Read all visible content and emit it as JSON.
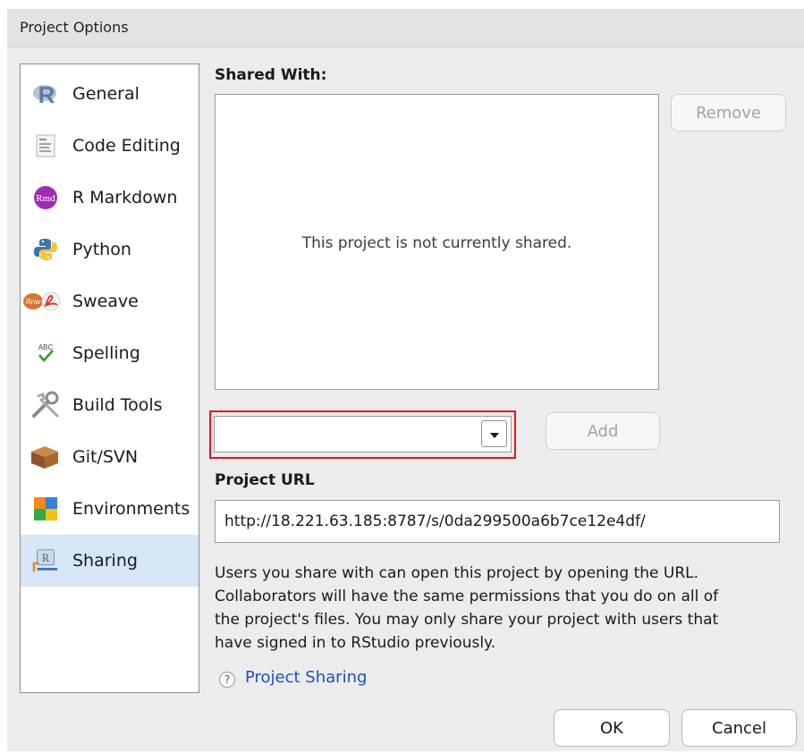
{
  "window": {
    "title": "Project Options"
  },
  "sidebar": {
    "items": [
      {
        "label": "General",
        "icon": "r-logo-icon"
      },
      {
        "label": "Code Editing",
        "icon": "code-document-icon"
      },
      {
        "label": "R Markdown",
        "icon": "rmd-icon",
        "icon_text": "Rmd"
      },
      {
        "label": "Python",
        "icon": "python-icon"
      },
      {
        "label": "Sweave",
        "icon": "sweave-icon",
        "icon_text": "Rnw"
      },
      {
        "label": "Spelling",
        "icon": "spelling-icon",
        "icon_text": "ABC"
      },
      {
        "label": "Build Tools",
        "icon": "build-tools-icon"
      },
      {
        "label": "Git/SVN",
        "icon": "git-box-icon"
      },
      {
        "label": "Environments",
        "icon": "environments-icon"
      },
      {
        "label": "Sharing",
        "icon": "sharing-icon",
        "selected": true
      }
    ]
  },
  "sharing": {
    "shared_with_label": "Shared With:",
    "empty_message": "This project is not currently shared.",
    "remove_label": "Remove",
    "add_label": "Add",
    "user_select_value": "",
    "project_url_label": "Project URL",
    "project_url": "http://18.221.63.185:8787/s/0da299500a6b7ce12e4df/",
    "info_lines": [
      "Users you share with can open this project by opening the URL.",
      "Collaborators will have the same permissions that you do on all of",
      "the project's files. You may only share your project with users that",
      "have signed in to RStudio previously."
    ],
    "help_icon_text": "?",
    "help_link": "Project Sharing"
  },
  "buttons": {
    "ok": "OK",
    "cancel": "Cancel"
  },
  "colors": {
    "selected_bg": "#d6e6f5",
    "highlight_border": "#e0161f",
    "link": "#1f4fc4"
  }
}
